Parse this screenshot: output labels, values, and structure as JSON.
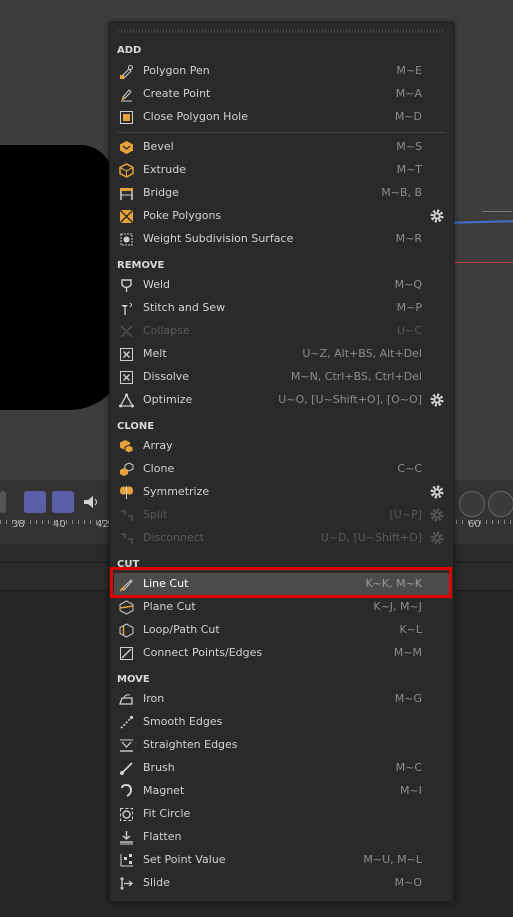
{
  "background": {
    "ticks": [
      "38",
      "40",
      "42",
      "60"
    ]
  },
  "sections": {
    "add": "ADD",
    "remove": "REMOVE",
    "clone": "CLONE",
    "cut": "CUT",
    "move": "MOVE"
  },
  "items": {
    "polygon_pen": {
      "label": "Polygon Pen",
      "shortcut": "M~E"
    },
    "create_point": {
      "label": "Create Point",
      "shortcut": "M~A"
    },
    "close_polygon_hole": {
      "label": "Close Polygon Hole",
      "shortcut": "M~D"
    },
    "bevel": {
      "label": "Bevel",
      "shortcut": "M~S"
    },
    "extrude": {
      "label": "Extrude",
      "shortcut": "M~T"
    },
    "bridge": {
      "label": "Bridge",
      "shortcut": "M~B, B"
    },
    "poke_polygons": {
      "label": "Poke Polygons",
      "shortcut": ""
    },
    "weight_subdivision_surface": {
      "label": "Weight Subdivision Surface",
      "shortcut": "M~R"
    },
    "weld": {
      "label": "Weld",
      "shortcut": "M~Q"
    },
    "stitch_and_sew": {
      "label": "Stitch and Sew",
      "shortcut": "M~P"
    },
    "collapse": {
      "label": "Collapse",
      "shortcut": "U~C"
    },
    "melt": {
      "label": "Melt",
      "shortcut": "U~Z, Alt+BS, Alt+Del"
    },
    "dissolve": {
      "label": "Dissolve",
      "shortcut": "M~N, Ctrl+BS, Ctrl+Del"
    },
    "optimize": {
      "label": "Optimize",
      "shortcut": "U~O, [U~Shift+O], [O~O]"
    },
    "array": {
      "label": "Array",
      "shortcut": ""
    },
    "clone": {
      "label": "Clone",
      "shortcut": "C~C"
    },
    "symmetrize": {
      "label": "Symmetrize",
      "shortcut": ""
    },
    "split": {
      "label": "Split",
      "shortcut": "[U~P]"
    },
    "disconnect": {
      "label": "Disconnect",
      "shortcut": "U~D, [U~Shift+D]"
    },
    "line_cut": {
      "label": "Line Cut",
      "shortcut": "K~K, M~K"
    },
    "plane_cut": {
      "label": "Plane Cut",
      "shortcut": "K~J, M~J"
    },
    "loop_path_cut": {
      "label": "Loop/Path Cut",
      "shortcut": "K~L"
    },
    "connect_points_edges": {
      "label": "Connect Points/Edges",
      "shortcut": "M~M"
    },
    "iron": {
      "label": "Iron",
      "shortcut": "M~G"
    },
    "smooth_edges": {
      "label": "Smooth Edges",
      "shortcut": ""
    },
    "straighten_edges": {
      "label": "Straighten Edges",
      "shortcut": ""
    },
    "brush": {
      "label": "Brush",
      "shortcut": "M~C"
    },
    "magnet": {
      "label": "Magnet",
      "shortcut": "M~I"
    },
    "fit_circle": {
      "label": "Fit Circle",
      "shortcut": ""
    },
    "flatten": {
      "label": "Flatten",
      "shortcut": ""
    },
    "set_point_value": {
      "label": "Set Point Value",
      "shortcut": "M~U, M~L"
    },
    "slide": {
      "label": "Slide",
      "shortcut": "M~O"
    }
  },
  "colors": {
    "accent_orange": "#e8a23a",
    "highlight_border": "#e10000",
    "menu_bg": "#2a2a2a"
  }
}
